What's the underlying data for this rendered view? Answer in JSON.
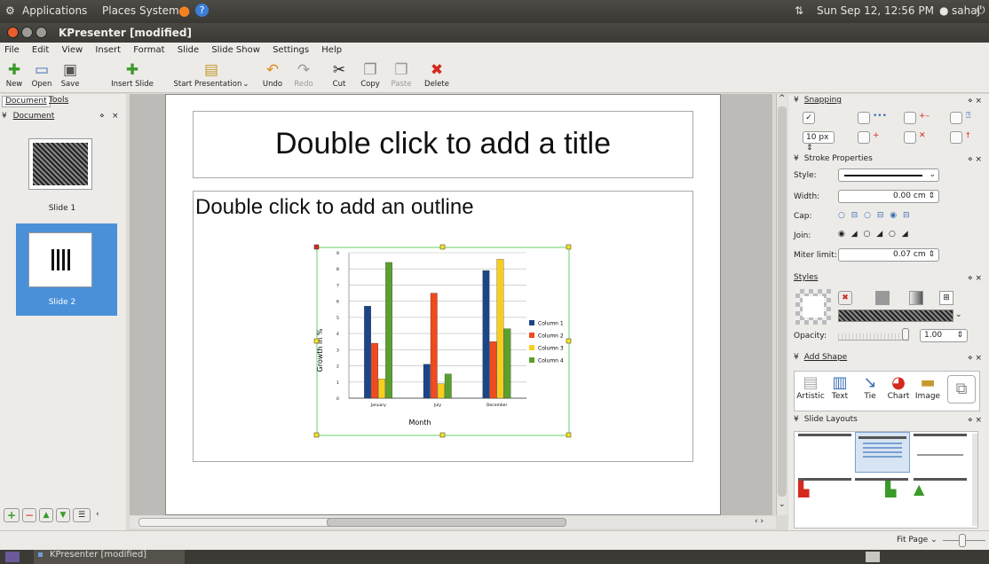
{
  "panel": {
    "applications": "Applications",
    "places": "Places",
    "system": "System",
    "clock": "Sun Sep 12, 12:56 PM",
    "user": "sahaj"
  },
  "window": {
    "title": "KPresenter [modified]"
  },
  "menu": [
    "File",
    "Edit",
    "View",
    "Insert",
    "Format",
    "Slide",
    "Slide Show",
    "Settings",
    "Help"
  ],
  "toolbar": {
    "new": "New",
    "open": "Open",
    "save": "Save",
    "insert_slide": "Insert Slide",
    "start_presentation": "Start Presentation",
    "undo": "Undo",
    "redo": "Redo",
    "cut": "Cut",
    "copy": "Copy",
    "paste": "Paste",
    "delete": "Delete"
  },
  "left_dock": {
    "tab_document": "Document",
    "tab_tools": "Tools",
    "panel_title": "Document",
    "slides": [
      {
        "label": "Slide 1"
      },
      {
        "label": "Slide 2"
      }
    ]
  },
  "slide": {
    "title_placeholder": "Double click to add a title",
    "outline_placeholder": "Double click to add an outline"
  },
  "chart_data": {
    "type": "bar",
    "categories": [
      "January",
      "July",
      "December"
    ],
    "series": [
      {
        "name": "Column 1",
        "values": [
          5.7,
          2.1,
          7.9
        ],
        "color": "#1c4587"
      },
      {
        "name": "Column 2",
        "values": [
          3.4,
          6.5,
          3.5
        ],
        "color": "#f04a1f"
      },
      {
        "name": "Column 3",
        "values": [
          1.2,
          0.9,
          8.6
        ],
        "color": "#f8ce1e"
      },
      {
        "name": "Column 4",
        "values": [
          8.4,
          1.5,
          4.3
        ],
        "color": "#5aa02c"
      }
    ],
    "xlabel": "Month",
    "ylabel": "Growth in %",
    "ylim": [
      0,
      9
    ],
    "yticks": [
      "0",
      "1",
      "2",
      "3",
      "4",
      "5",
      "6",
      "7",
      "8",
      "9"
    ],
    "legend": "right",
    "grid": true
  },
  "snapping": {
    "title": "Snapping",
    "spacing": "10 px"
  },
  "stroke": {
    "title": "Stroke Properties",
    "style_label": "Style:",
    "width_label": "Width:",
    "width_value": "0.00 cm",
    "cap_label": "Cap:",
    "join_label": "Join:",
    "miter_label": "Miter limit:",
    "miter_value": "0.07 cm"
  },
  "styles": {
    "title": "Styles",
    "opacity_label": "Opacity:",
    "opacity_value": "1.00",
    "opacity_fraction": 1.0
  },
  "add_shape": {
    "title": "Add Shape",
    "items": [
      "Artistic",
      "Text",
      "Tie",
      "Chart",
      "Image"
    ]
  },
  "slide_layouts": {
    "title": "Slide Layouts"
  },
  "status": {
    "zoom": "Fit Page"
  },
  "taskbar": {
    "window": "KPresenter [modified]"
  },
  "colors": {
    "selection": "#4a90d9",
    "chart_frame": "#7fd87f"
  }
}
